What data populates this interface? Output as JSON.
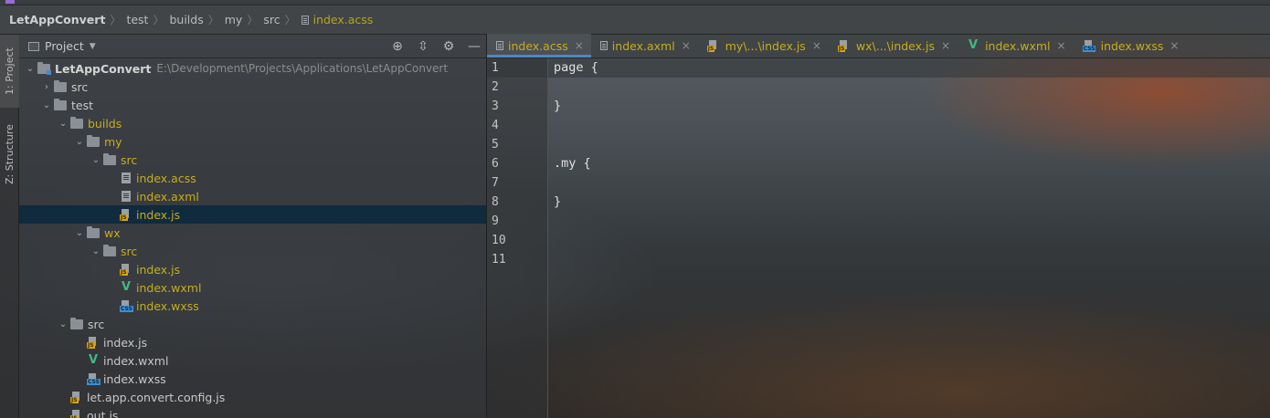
{
  "breadcrumb": {
    "project": "LetAppConvert",
    "items": [
      "test",
      "builds",
      "my",
      "src"
    ],
    "file": "index.acss"
  },
  "toolstrip": {
    "project_tab": "1: Project",
    "structure_tab": "Z: Structure"
  },
  "project_panel": {
    "title": "Project",
    "tools": [
      "locate-icon",
      "collapse-icon",
      "gear-icon",
      "minimize-icon"
    ]
  },
  "tree": {
    "root": {
      "label": "LetAppConvert",
      "path": "E:\\Development\\Projects\\Applications\\LetAppConvert"
    },
    "rows": [
      {
        "label": "src"
      },
      {
        "label": "test"
      },
      {
        "label": "builds"
      },
      {
        "label": "my"
      },
      {
        "label": "src"
      },
      {
        "label": "index.acss"
      },
      {
        "label": "index.axml"
      },
      {
        "label": "index.js",
        "selected": true
      },
      {
        "label": "wx"
      },
      {
        "label": "src"
      },
      {
        "label": "index.js"
      },
      {
        "label": "index.wxml"
      },
      {
        "label": "index.wxss"
      },
      {
        "label": "src"
      },
      {
        "label": "index.js"
      },
      {
        "label": "index.wxml"
      },
      {
        "label": "index.wxss"
      },
      {
        "label": "let.app.convert.config.js"
      },
      {
        "label": "out.js"
      }
    ]
  },
  "tabs": [
    {
      "label": "index.acss",
      "active": true
    },
    {
      "label": "index.axml"
    },
    {
      "label": "my\\...\\index.js"
    },
    {
      "label": "wx\\...\\index.js"
    },
    {
      "label": "index.wxml"
    },
    {
      "label": "index.wxss"
    }
  ],
  "editor": {
    "line_numbers": [
      "1",
      "2",
      "3",
      "4",
      "5",
      "6",
      "7",
      "8",
      "9",
      "10",
      "11"
    ],
    "lines": [
      "page {",
      "",
      "}",
      "",
      "",
      ".my {",
      "",
      "}",
      "",
      "",
      ""
    ],
    "current_line": 1
  },
  "icon_badges": {
    "js": "JS",
    "css": "CSS",
    "vue": "V"
  },
  "colors": {
    "accent": "#4a88c7",
    "file_modified": "#c7ad1c",
    "selection": "#0d293e",
    "vue": "#41b883"
  }
}
